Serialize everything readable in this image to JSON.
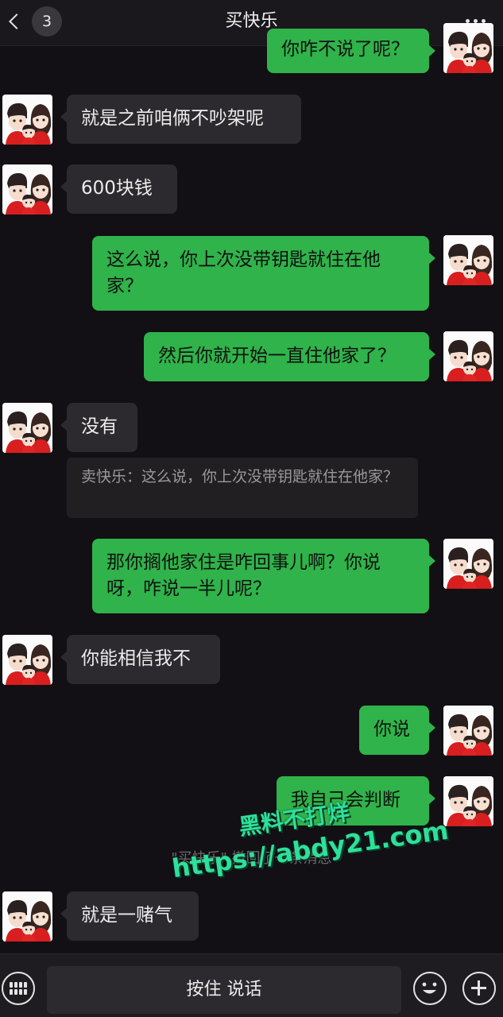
{
  "header": {
    "back_count": "3",
    "title": "买快乐"
  },
  "messages": [
    {
      "side": "out",
      "text": "你咋不说了呢？"
    },
    {
      "side": "in",
      "text": "就是之前咱俩不吵架呢"
    },
    {
      "side": "in",
      "text": "600块钱"
    },
    {
      "side": "out",
      "text": "这么说，你上次没带钥匙就住在他家？"
    },
    {
      "side": "out",
      "text": "然后你就开始一直住他家了？"
    },
    {
      "side": "in",
      "text": "没有"
    },
    {
      "side": "quote",
      "text": "卖快乐：这么说，你上次没带钥匙就住在他家？"
    },
    {
      "side": "out",
      "text": "那你搁他家住是咋回事儿啊？你说呀，咋说一半儿呢？"
    },
    {
      "side": "in",
      "text": "你能相信我不"
    },
    {
      "side": "out",
      "text": "你说"
    },
    {
      "side": "out",
      "text": "我自己会判断"
    },
    {
      "side": "system",
      "text": "\"买快乐\" 撤回了一条消息"
    },
    {
      "side": "in",
      "text": "就是一赌气"
    }
  ],
  "watermark": {
    "line1": "黑料不打烊",
    "line2": "https://abdy21.com"
  },
  "bottom_bar": {
    "talk_label": "按住 说话"
  },
  "icons": {
    "back": "chevron-left-icon",
    "more": "more-dots-icon",
    "keyboard": "keyboard-icon",
    "emoji": "emoji-icon",
    "add": "plus-icon"
  },
  "colors": {
    "background": "#121014",
    "incoming_bubble": "#2c2a2e",
    "outgoing_bubble": "#2fb34a",
    "watermark": "#2ee09a"
  }
}
